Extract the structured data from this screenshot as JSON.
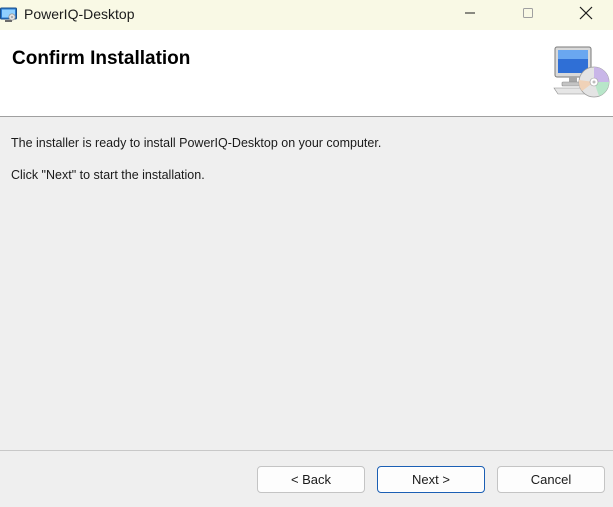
{
  "window": {
    "title": "PowerIQ-Desktop",
    "icon": "installer-app-icon",
    "controls": [
      "minimize-icon",
      "maximize-icon",
      "close-icon"
    ]
  },
  "header": {
    "title": "Confirm Installation",
    "graphic": "computer-cd-icon"
  },
  "body": {
    "line1": "The installer is ready to install PowerIQ-Desktop on your computer.",
    "line2": "Click \"Next\" to start the installation."
  },
  "footer": {
    "back_label": "< Back",
    "next_label": "Next >",
    "cancel_label": "Cancel"
  },
  "colors": {
    "titlebar_bg": "#f9f9e5",
    "content_bg": "#efefef",
    "default_button_border": "#1b5fb4"
  }
}
